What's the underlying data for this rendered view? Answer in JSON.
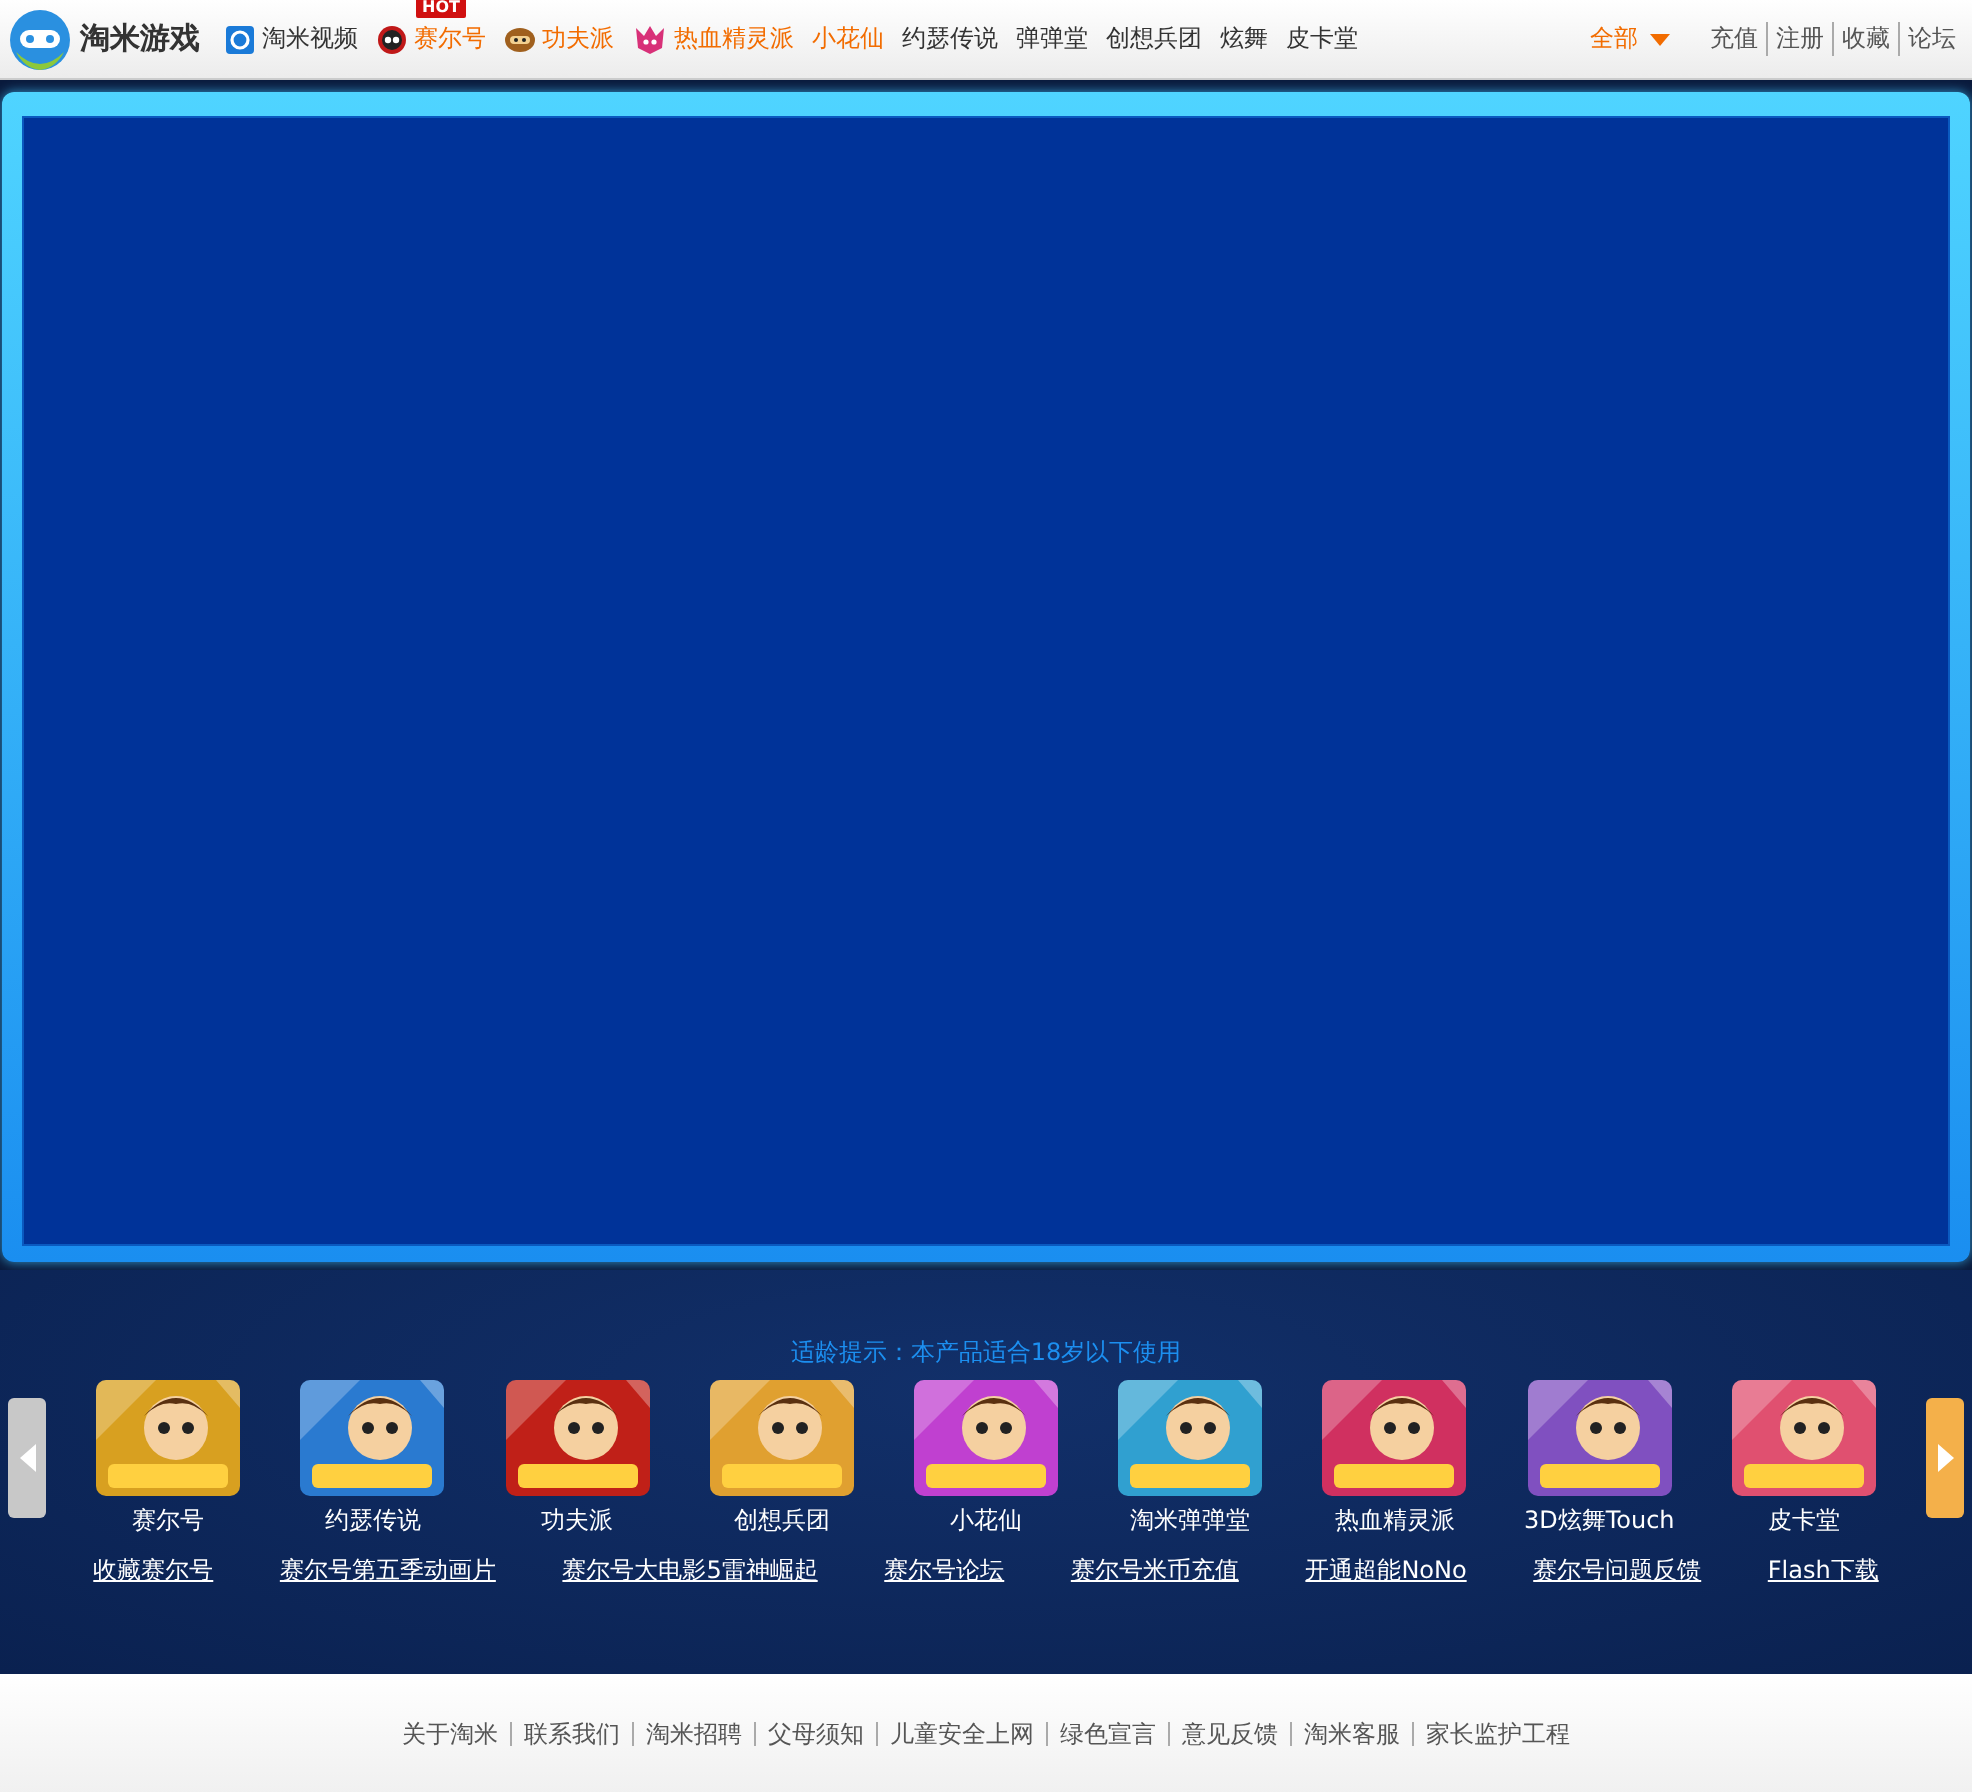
{
  "header": {
    "logo": "淘米游戏",
    "nav": [
      {
        "label": "淘米视频",
        "highlight": false,
        "kind": "video"
      },
      {
        "label": "赛尔号",
        "highlight": true,
        "kind": "robot",
        "badge": "HOT"
      },
      {
        "label": "功夫派",
        "highlight": true,
        "kind": "monkey"
      },
      {
        "label": "热血精灵派",
        "highlight": true,
        "kind": "spirit"
      },
      {
        "label": "小花仙",
        "highlight": true
      },
      {
        "label": "约瑟传说",
        "highlight": false
      },
      {
        "label": "弹弹堂",
        "highlight": false
      },
      {
        "label": "创想兵团",
        "highlight": false
      },
      {
        "label": "炫舞",
        "highlight": false
      },
      {
        "label": "皮卡堂",
        "highlight": false
      }
    ],
    "all_menu": "全部",
    "links": [
      "充值",
      "注册",
      "收藏",
      "论坛"
    ]
  },
  "notice": "适龄提示：本产品适合18岁以下使用",
  "games": [
    {
      "name": "赛尔号",
      "color": "#d8a020"
    },
    {
      "name": "约瑟传说",
      "color": "#2a7ad0"
    },
    {
      "name": "功夫派",
      "color": "#c02018"
    },
    {
      "name": "创想兵团",
      "color": "#e0a030"
    },
    {
      "name": "小花仙",
      "color": "#c040d0"
    },
    {
      "name": "淘米弹弹堂",
      "color": "#30a0d0"
    },
    {
      "name": "热血精灵派",
      "color": "#d03060"
    },
    {
      "name": "3D炫舞Touch",
      "color": "#8050c0"
    },
    {
      "name": "皮卡堂",
      "color": "#e05070"
    }
  ],
  "quick_links": [
    "收藏赛尔号",
    "赛尔号第五季动画片",
    "赛尔号大电影5雷神崛起",
    "赛尔号论坛",
    "赛尔号米币充值",
    "开通超能NoNo",
    "赛尔号问题反馈",
    "Flash下载"
  ],
  "footer_links": [
    "关于淘米",
    "联系我们",
    "淘米招聘",
    "父母须知",
    "儿童安全上网",
    "绿色宣言",
    "意见反馈",
    "淘米客服",
    "家长监护工程"
  ]
}
